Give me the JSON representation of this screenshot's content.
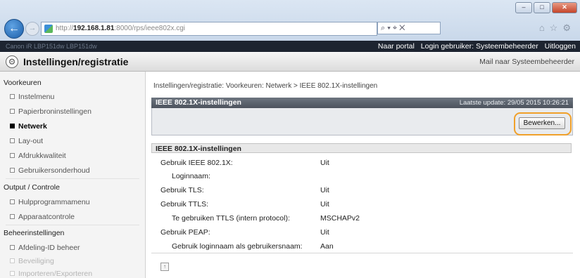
{
  "browser": {
    "url_prefix": "http://",
    "url_host": "192.168.1.81",
    "url_path": ":8000/rps/ieee802x.cgi",
    "addr_tools": "⌕ ▾ ⌖ ✕",
    "window_buttons": [
      "–",
      "□",
      "✕"
    ],
    "toolbar_icons": "⌂☆⚙"
  },
  "portal": {
    "device": "Canon iR  LBP151dw  LBP151dw",
    "links": [
      "Naar portal",
      "Login gebruiker: Systeembeheerder",
      "Uitloggen"
    ]
  },
  "header": {
    "title": "Instellingen/registratie",
    "mail_link": "Mail naar Systeembeheerder",
    "gear_glyph": "⚙"
  },
  "sidebar": {
    "sections": [
      {
        "title": "Voorkeuren",
        "items": [
          {
            "label": "Instelmenu"
          },
          {
            "label": "Papierbroninstellingen"
          },
          {
            "label": "Netwerk"
          },
          {
            "label": "Lay-out"
          },
          {
            "label": "Afdrukkwaliteit"
          },
          {
            "label": "Gebruikersonderhoud"
          }
        ]
      },
      {
        "title": "Output / Controle",
        "items": [
          {
            "label": "Hulpprogrammamenu"
          },
          {
            "label": "Apparaatcontrole"
          }
        ]
      },
      {
        "title": "Beheerinstellingen",
        "items": [
          {
            "label": "Afdeling-ID beheer"
          },
          {
            "label": "Beveiliging"
          },
          {
            "label": "Importeren/Exporteren"
          }
        ]
      }
    ]
  },
  "main": {
    "breadcrumb": "Instellingen/registratie: Voorkeuren: Netwerk > IEEE 802.1X-instellingen",
    "panel_title": "IEEE 802.1X-instellingen",
    "last_update": "Laatste update: 29/05 2015 10:26:21",
    "edit_button": "Bewerken...",
    "section_title": "IEEE 802.1X-instellingen",
    "rows": [
      {
        "label": "Gebruik IEEE 802.1X:",
        "value": "Uit"
      },
      {
        "label": "Loginnaam:",
        "value": ""
      },
      {
        "label": "Gebruik TLS:",
        "value": "Uit"
      },
      {
        "label": "Gebruik TTLS:",
        "value": "Uit"
      },
      {
        "label": "Te gebruiken TTLS (intern protocol):",
        "value": "MSCHAPv2"
      },
      {
        "label": "Gebruik PEAP:",
        "value": "Uit"
      },
      {
        "label": "Gebruik loginnaam als gebruikersnaam:",
        "value": "Aan"
      }
    ],
    "top_glyph": "↑"
  },
  "colors": {
    "highlight": "#f0a02a",
    "panel_header": "#5a616b",
    "portal_bar": "#1d2430"
  }
}
